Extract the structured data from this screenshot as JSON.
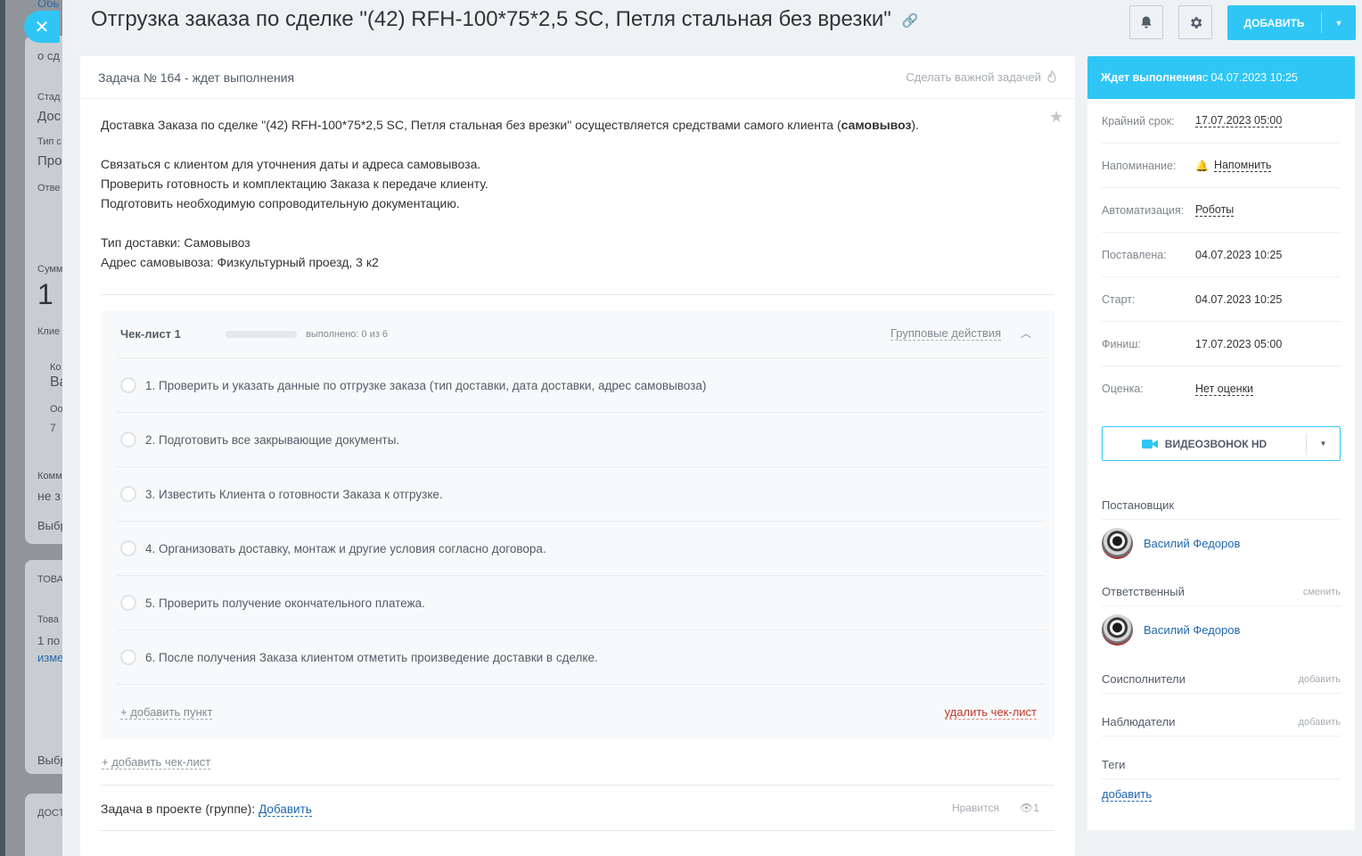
{
  "task": {
    "title": "Отгрузка заказа по сделке \"(42) RFH-100*75*2,5 SC, Петля стальная без врезки\"",
    "header_label": "Задача № 164 - ждет выполнения",
    "important_label": "Сделать важной задачей",
    "add_button": "ДОБАВИТЬ",
    "description": [
      "Доставка Заказа по сделке \"(42) RFH-100*75*2,5 SC, Петля стальная без врезки\" осуществляется средствами самого клиента (",
      "самовывоз",
      ").",
      "Связаться с клиентом для уточнения даты и адреса самовывоза.",
      "Проверить готовность и комплектацию Заказа к передаче клиенту.",
      "Подготовить необходимую сопроводительную документацию.",
      "Тип доставки: Самовывоз",
      "Адрес самовывоза: Физкультурный проезд, 3 к2"
    ]
  },
  "checklist": {
    "title": "Чек-лист 1",
    "progress": 0,
    "status": "выполнено: 0 из 6",
    "group_actions": "Групповые действия",
    "items": [
      "1. Проверить и указать данные по отгрузке заказа (тип доставки, дата доставки, адрес самовывоза)",
      "2. Подготовить все закрывающие документы.",
      "3. Известить Клиента о готовности Заказа к отгрузке.",
      "4. Организовать доставку, монтаж и другие условия согласно договора.",
      "5. Проверить получение окончательного платежа.",
      "6. После получения Заказа клиентом отметить произведение доставки в сделке."
    ],
    "add_item": "+ добавить пункт",
    "delete": "удалить чек-лист",
    "add_checklist": "+ добавить чек-лист"
  },
  "project": {
    "label": "Задача в проекте (группе):",
    "add": "Добавить",
    "like": "Нравится",
    "views": "1"
  },
  "sidebar": {
    "status_bold": "Ждет выполнения",
    "status_rest": " с 04.07.2023 10:25",
    "rows": [
      {
        "k": "Крайний срок:",
        "v": "17.07.2023 05:00"
      },
      {
        "k": "Напоминание:",
        "v": "Напомнить"
      },
      {
        "k": "Автоматизация:",
        "v": "Роботы"
      },
      {
        "k": "Поставлена:",
        "v": "04.07.2023 10:25"
      },
      {
        "k": "Старт:",
        "v": "04.07.2023 10:25"
      },
      {
        "k": "Финиш:",
        "v": "17.07.2023 05:00"
      },
      {
        "k": "Оценка:",
        "v": "Нет оценки"
      }
    ],
    "video_button": "ВИДЕОЗВОНОК HD",
    "creator_title": "Постановщик",
    "creator_name": "Василий Федоров",
    "responsible_title": "Ответственный",
    "responsible_change": "сменить",
    "responsible_name": "Василий Федоров",
    "accomplices_title": "Соисполнители",
    "accomplices_add": "добавить",
    "auditors_title": "Наблюдатели",
    "auditors_add": "добавить",
    "tags_title": "Теги",
    "tags_add": "добавить"
  },
  "background": {
    "texts": [
      "Обь",
      "о сд",
      "Стад",
      "Дос",
      "Тип с",
      "Про",
      "Отве",
      "Сумм",
      "1",
      "Клие",
      "Ко",
      "Ва",
      "Оо",
      "7",
      "Комм",
      "не з",
      "Выбр",
      "ТОВА",
      "Това",
      "1 по",
      "изме",
      "Выбр",
      "ДОСТ"
    ]
  },
  "colors": {
    "accent": "#2fc6f6",
    "link": "#2067b0",
    "danger": "#c0392b"
  }
}
